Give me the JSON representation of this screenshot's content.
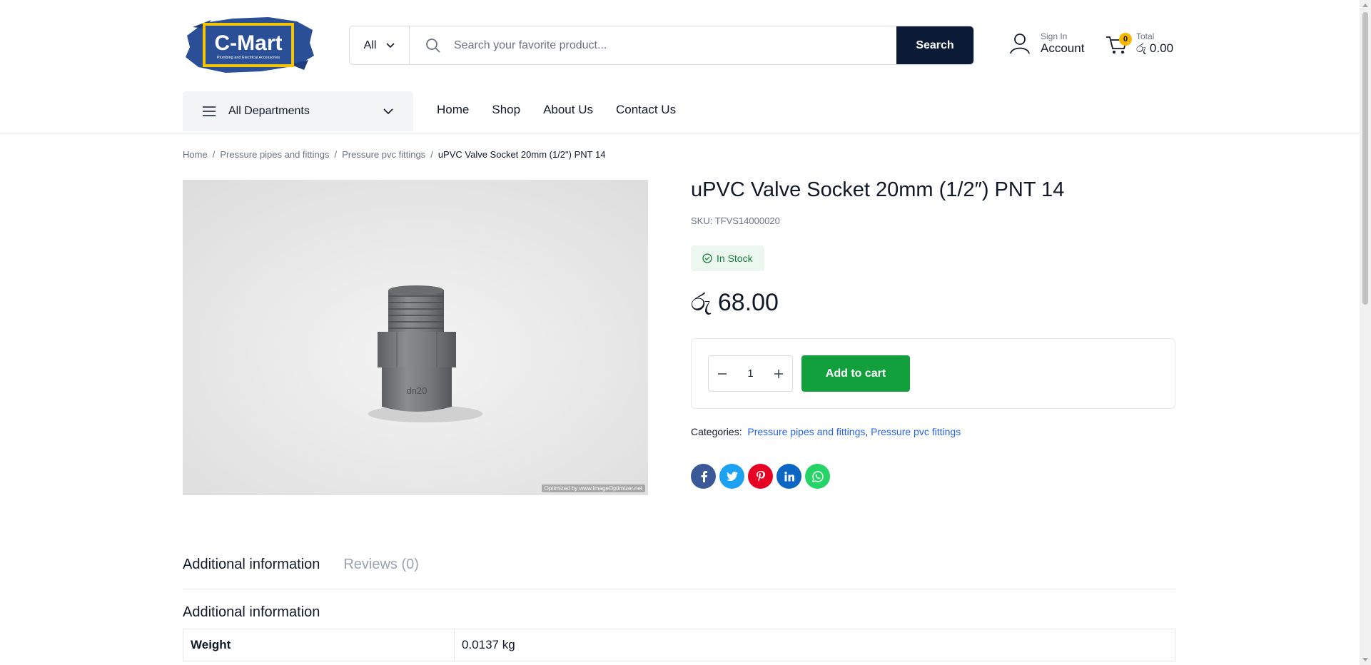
{
  "brand": {
    "logo_text": "C-Mart",
    "logo_tagline": "Plumbing and Electrical Accessories",
    "brand_blue": "#2a4f97",
    "accent_yellow": "#f5c400"
  },
  "search": {
    "category": "All",
    "placeholder": "Search your favorite product...",
    "button_label": "Search"
  },
  "account": {
    "small": "Sign In",
    "label": "Account"
  },
  "cart": {
    "count": "0",
    "small": "Total",
    "total": "රු 0.00"
  },
  "nav": {
    "departments": "All Departments",
    "menu": [
      "Home",
      "Shop",
      "About Us",
      "Contact Us"
    ]
  },
  "breadcrumb": [
    "Home",
    "Pressure pipes and fittings",
    "Pressure pvc fittings",
    "uPVC Valve Socket 20mm (1/2\") PNT 14"
  ],
  "product": {
    "title": "uPVC Valve Socket 20mm (1/2″) PNT 14",
    "sku_label": "SKU:",
    "sku": "TFVS14000020",
    "stock": "In Stock",
    "price": "රු 68.00",
    "qty": "1",
    "add_to_cart": "Add to cart",
    "categories_label": "Categories:",
    "categories": [
      "Pressure pipes and fittings",
      "Pressure pvc fittings"
    ],
    "image_watermark": "Optimized by www.ImageOptimizer.net",
    "image_markings": [
      "dn20"
    ]
  },
  "share": [
    {
      "name": "facebook",
      "glyph": "f",
      "color": "#3b5998"
    },
    {
      "name": "twitter",
      "glyph": "t",
      "color": "#1da1f2"
    },
    {
      "name": "pinterest",
      "glyph": "P",
      "color": "#e60023"
    },
    {
      "name": "linkedin",
      "glyph": "in",
      "color": "#0a66c2"
    },
    {
      "name": "whatsapp",
      "glyph": "w",
      "color": "#25d366"
    }
  ],
  "tabs": {
    "additional": "Additional information",
    "reviews": "Reviews (0)"
  },
  "additional": {
    "title": "Additional information",
    "rows": [
      {
        "label": "Weight",
        "value": "0.0137 kg"
      }
    ]
  }
}
